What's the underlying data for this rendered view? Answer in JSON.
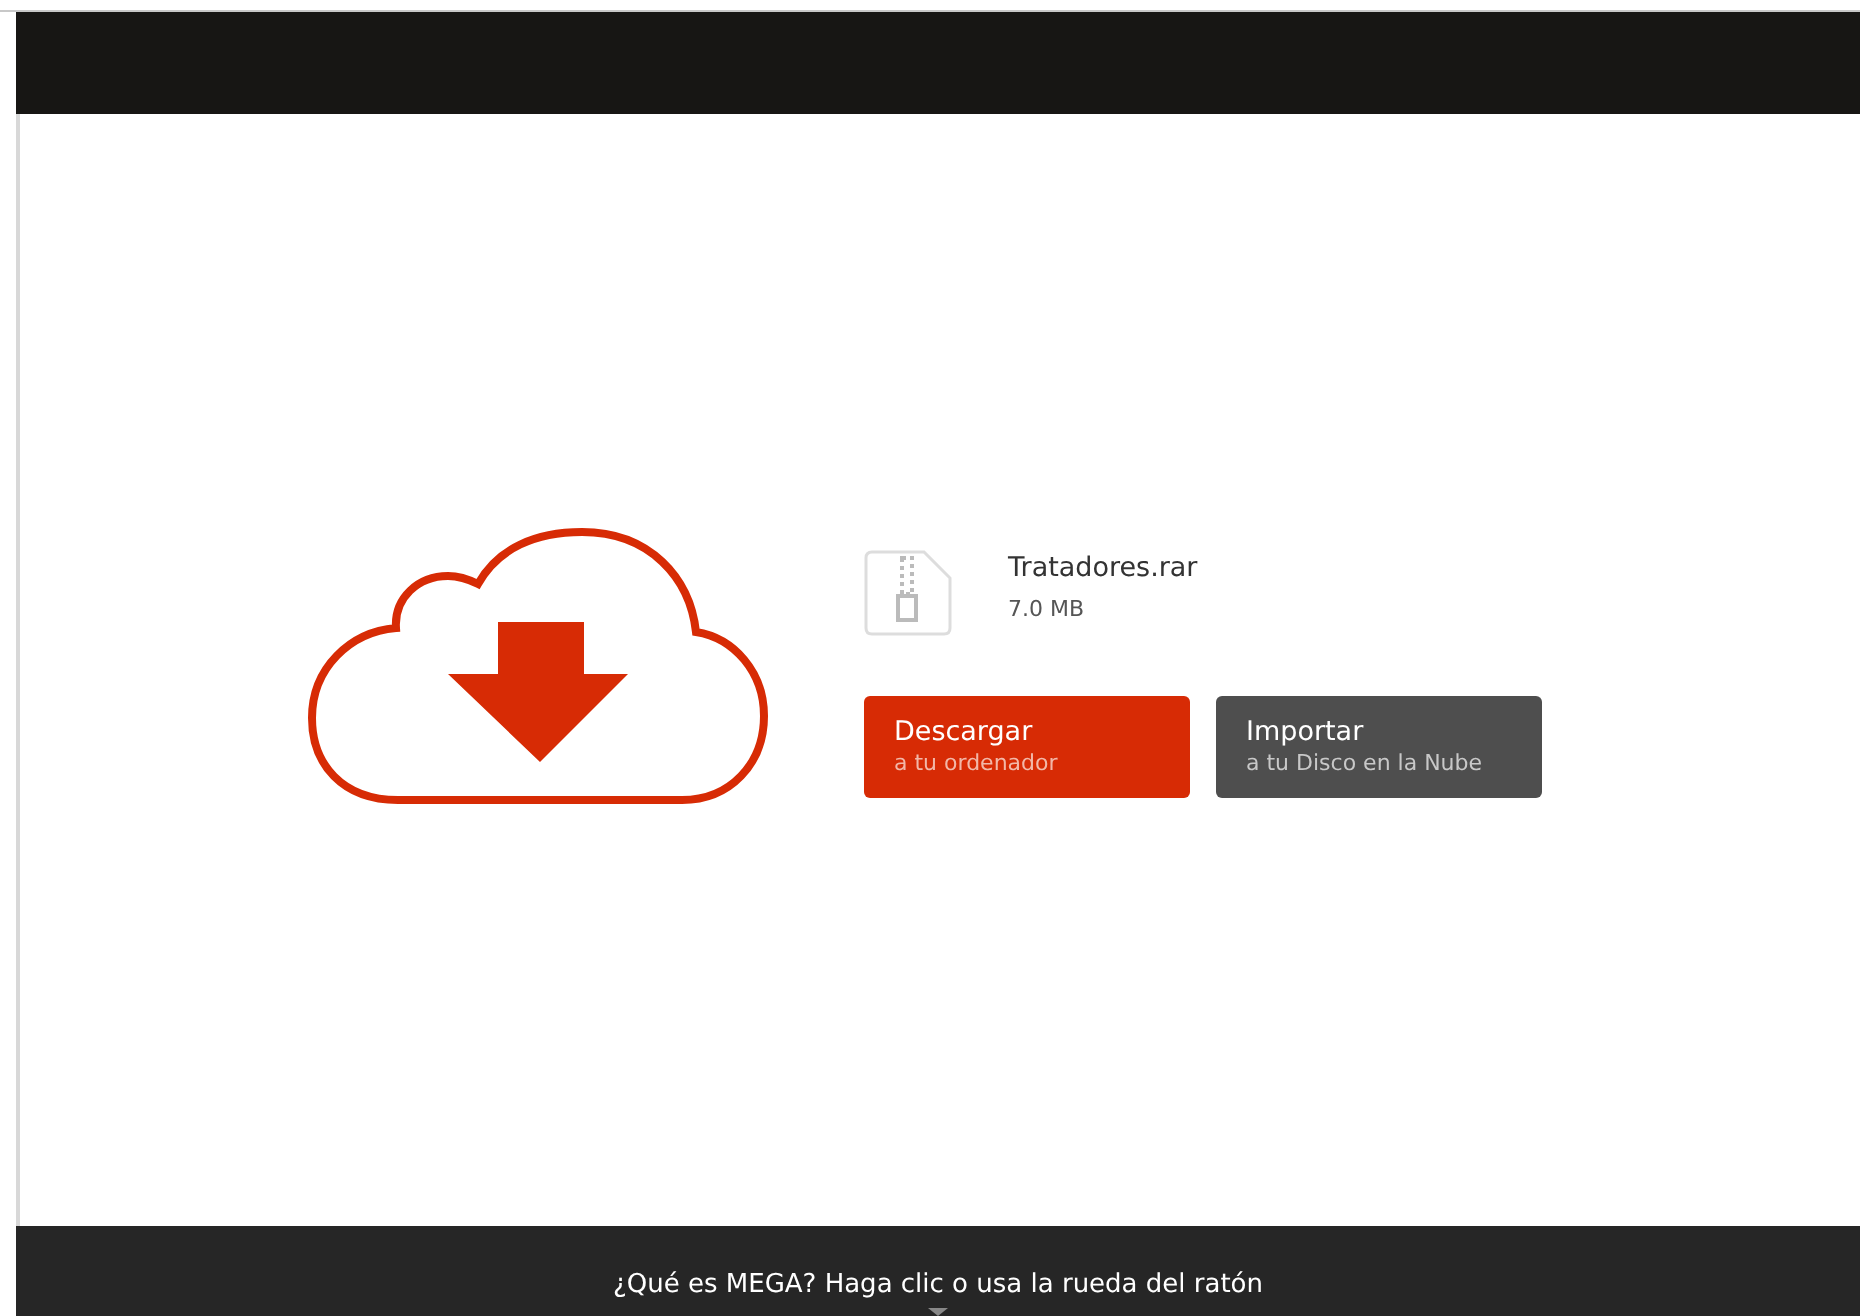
{
  "file": {
    "name": "Tratadores.rar",
    "size": "7.0 MB"
  },
  "buttons": [
    {
      "kind": "primary",
      "label": "Descargar",
      "sublabel": "a tu ordenador"
    },
    {
      "kind": "secondary",
      "label": "Importar",
      "sublabel": "a tu Disco en la Nube"
    }
  ],
  "footer": {
    "text": "¿Qué es MEGA? Haga clic o usa la rueda del ratón"
  }
}
